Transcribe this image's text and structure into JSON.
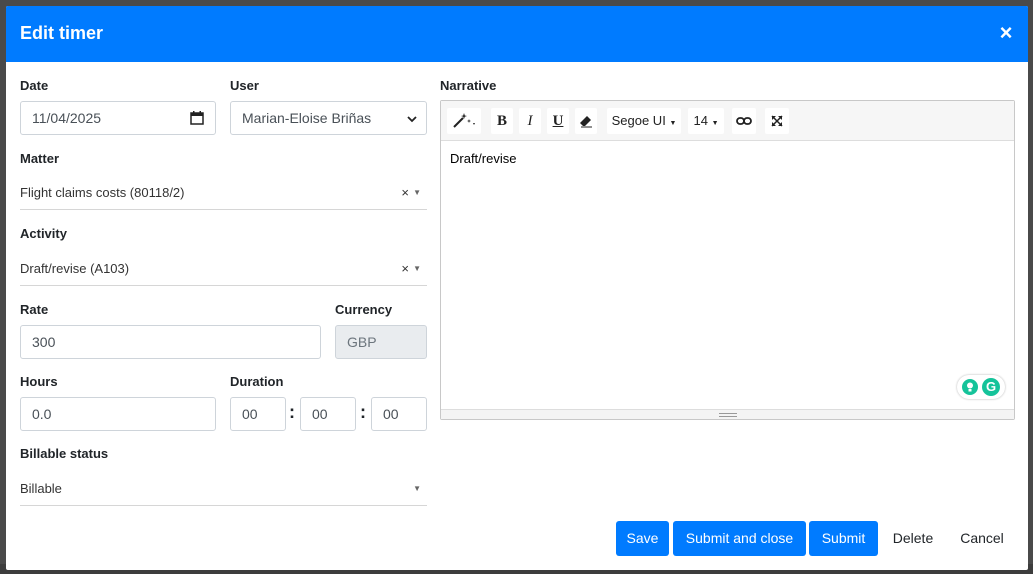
{
  "modal": {
    "title": "Edit timer"
  },
  "form": {
    "date": {
      "label": "Date",
      "value": "11/04/2025"
    },
    "user": {
      "label": "User",
      "value": "Marian-Eloise Briñas"
    },
    "matter": {
      "label": "Matter",
      "value": "Flight claims costs (80118/2)"
    },
    "activity": {
      "label": "Activity",
      "value": "Draft/revise (A103)"
    },
    "rate": {
      "label": "Rate",
      "value": "300"
    },
    "currency": {
      "label": "Currency",
      "value": "GBP"
    },
    "hours": {
      "label": "Hours",
      "value": "0.0"
    },
    "duration": {
      "label": "Duration",
      "hh": "00",
      "mm": "00",
      "ss": "00"
    },
    "billable_status": {
      "label": "Billable status",
      "value": "Billable"
    }
  },
  "narrative": {
    "label": "Narrative",
    "font": "Segoe UI",
    "size": "14",
    "body": "Draft/revise"
  },
  "footer": {
    "save": "Save",
    "submit_close": "Submit and close",
    "submit": "Submit",
    "delete": "Delete",
    "cancel": "Cancel"
  },
  "colors": {
    "primary": "#007bff",
    "grammarly": "#15c39a"
  }
}
